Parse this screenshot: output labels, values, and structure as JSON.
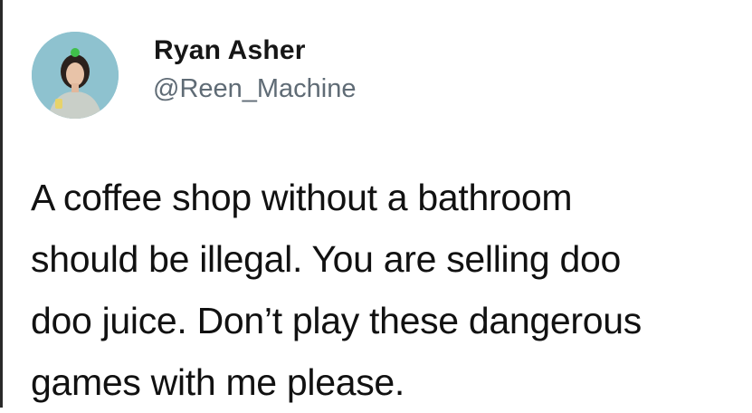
{
  "tweet": {
    "author": {
      "display_name": "Ryan Asher",
      "handle": "@Reen_Machine",
      "avatar_icon": "profile-photo"
    },
    "text_lines": [
      "A coffee shop without a bathroom",
      "should be illegal. You are selling doo",
      "doo juice. Don’t play these dangerous",
      "games with me please."
    ]
  },
  "colors": {
    "background": "#ffffff",
    "text": "#111111",
    "handle": "#5f6b75",
    "avatar_bg": "#8ec2cf"
  }
}
